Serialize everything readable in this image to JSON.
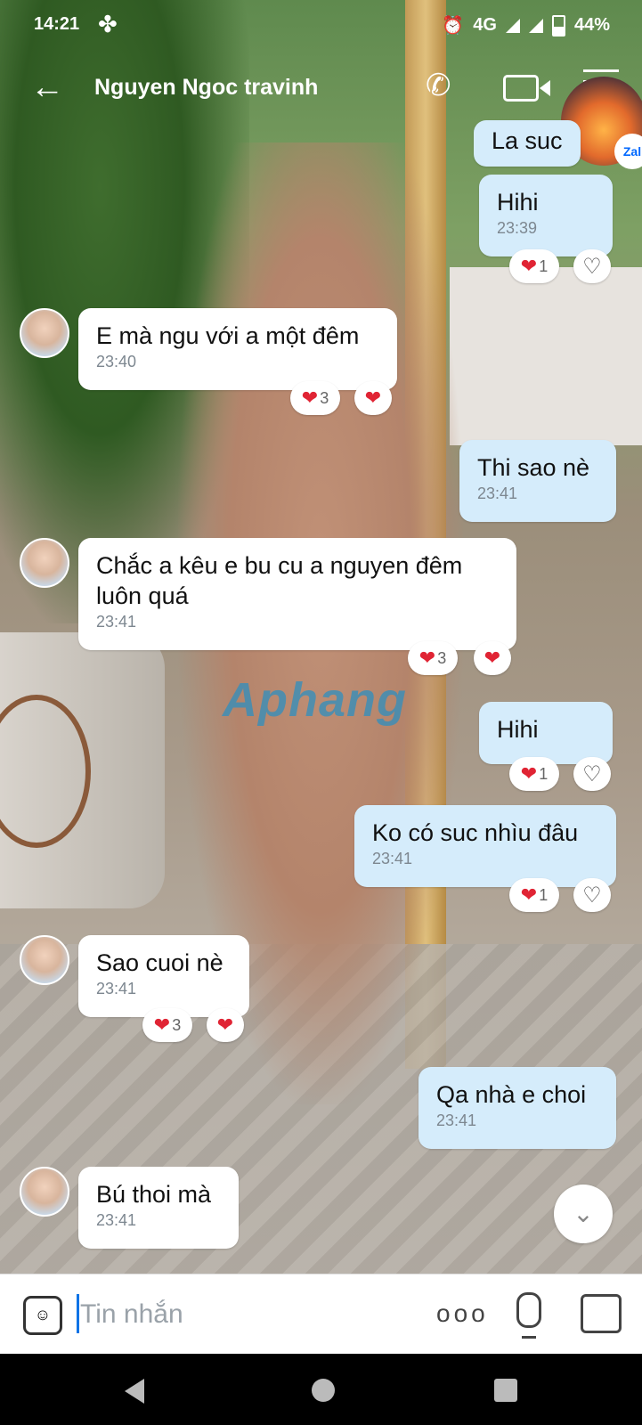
{
  "status_bar": {
    "time": "14:21",
    "network": "4G",
    "battery": "44%"
  },
  "header": {
    "contact_name": "Nguyen Ngoc travinh",
    "zalo_badge": "Zal"
  },
  "watermark": "Aphang",
  "messages": [
    {
      "dir": "out",
      "text": "La suc",
      "time": ""
    },
    {
      "dir": "out",
      "text": "Hihi",
      "time": "23:39",
      "reaction_count": "1"
    },
    {
      "dir": "in",
      "text": "E mà ngu với a một đêm",
      "time": "23:40",
      "reaction_count": "3"
    },
    {
      "dir": "out",
      "text": "Thi sao nè",
      "time": "23:41"
    },
    {
      "dir": "in",
      "text": "Chắc a kêu e bu cu a nguyen đêm luôn quá",
      "time": "23:41",
      "reaction_count": "3"
    },
    {
      "dir": "out",
      "text": "Hihi",
      "time": "",
      "reaction_count": "1"
    },
    {
      "dir": "out",
      "text": "Ko có suc nhìu đâu",
      "time": "23:41",
      "reaction_count": "1"
    },
    {
      "dir": "in",
      "text": "Sao cuoi nè",
      "time": "23:41",
      "reaction_count": "3"
    },
    {
      "dir": "out",
      "text": "Qa nhà e choi",
      "time": "23:41"
    },
    {
      "dir": "in",
      "text": "Bú thoi mà",
      "time": "23:41"
    }
  ],
  "input": {
    "placeholder": "Tin nhắn",
    "more": "ooo"
  },
  "icons": {
    "back": "arrow-left-icon",
    "call": "phone-icon",
    "video": "video-icon",
    "menu": "menu-icon",
    "emoji": "emoji-icon",
    "mic": "microphone-icon",
    "image": "image-icon"
  },
  "colors": {
    "incoming_bubble": "#ffffff",
    "outgoing_bubble": "#d5ecfb",
    "heart": "#e02434",
    "caret": "#0a73e6"
  }
}
